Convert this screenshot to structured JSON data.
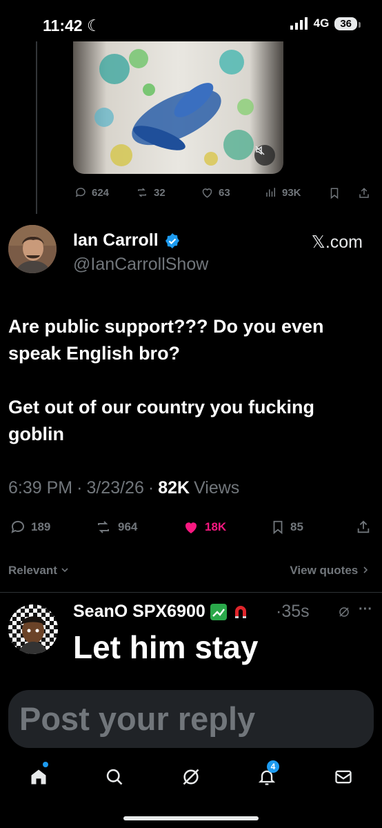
{
  "status_bar": {
    "time": "11:42",
    "network": "4G",
    "battery": "36"
  },
  "parent_tweet": {
    "stats": {
      "replies": "624",
      "reposts": "32",
      "likes": "63",
      "views": "93K"
    }
  },
  "tweet": {
    "author_name": "Ian Carroll",
    "handle": "@IanCarrollShow",
    "source": "𝕏.com",
    "text": "Are public support??? Do you even speak English bro?\n\nGet out of our country you fucking goblin",
    "time": "6:39 PM",
    "date": "3/23/26",
    "views_count": "82K",
    "views_label": "Views",
    "stats": {
      "replies": "189",
      "reposts": "964",
      "likes": "18K",
      "bookmarks": "85"
    },
    "like_color": "#f91880"
  },
  "sort": {
    "label": "Relevant",
    "view_quotes": "View quotes"
  },
  "reply": {
    "author_name": "SeanO SPX6900",
    "time": "·35s",
    "text": "Let him stay"
  },
  "composer": {
    "placeholder": "Post your reply"
  },
  "tab_bar": {
    "notifications_count": "4"
  },
  "colors": {
    "accent": "#1d9bf0",
    "muted": "#71767b",
    "background": "#000000"
  }
}
